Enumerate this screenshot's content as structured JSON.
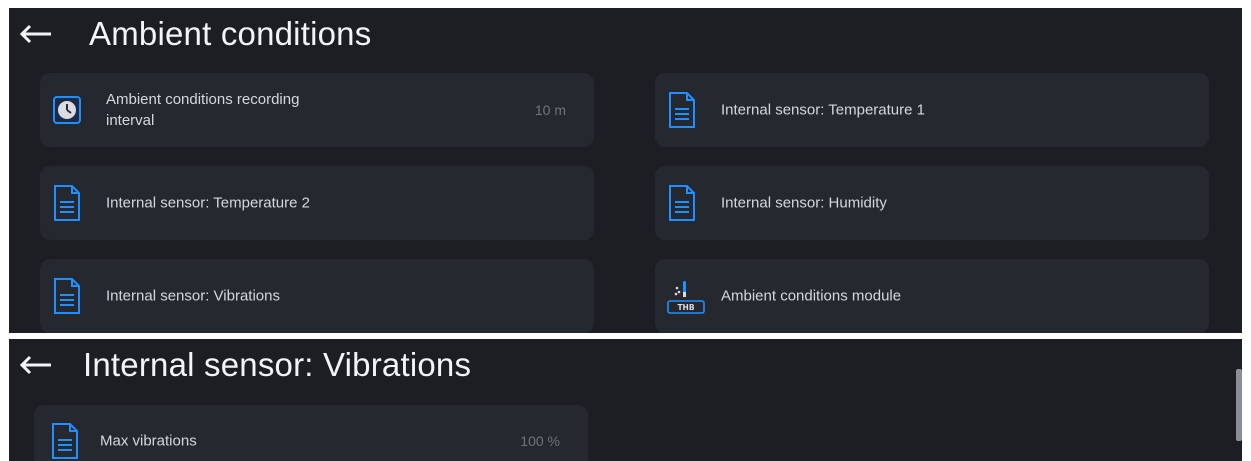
{
  "screen1": {
    "title": "Ambient conditions",
    "tiles": [
      {
        "label": "Ambient conditions recording interval",
        "value": "10 m",
        "icon": "clock-icon"
      },
      {
        "label": "Internal sensor: Temperature 1",
        "icon": "document-icon"
      },
      {
        "label": "Internal sensor: Temperature 2",
        "icon": "document-icon"
      },
      {
        "label": "Internal sensor: Humidity",
        "icon": "document-icon"
      },
      {
        "label": "Internal sensor: Vibrations",
        "icon": "document-icon"
      },
      {
        "label": "Ambient conditions module",
        "icon": "thb-module-icon",
        "icon_text": "THB"
      }
    ]
  },
  "screen2": {
    "title": "Internal sensor: Vibrations",
    "tiles": [
      {
        "label": "Max vibrations",
        "value": "100 %",
        "icon": "document-icon"
      }
    ]
  },
  "colors": {
    "background": "#1c1e23",
    "tile": "#25282e",
    "accent": "#1e90ff",
    "text": "#d4d8de",
    "muted": "#6f747d"
  }
}
